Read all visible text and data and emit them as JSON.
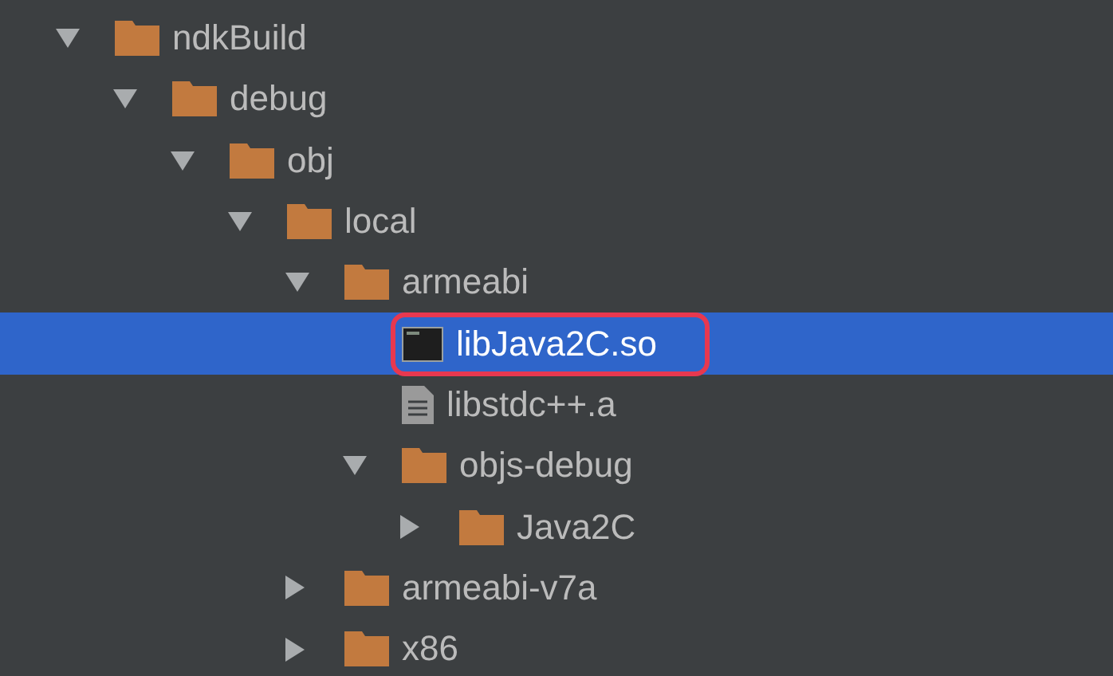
{
  "tree": [
    {
      "label": "ndkBuild",
      "kind": "folder",
      "expanded": true,
      "selected": false,
      "highlighted": false,
      "children": [
        {
          "label": "debug",
          "kind": "folder",
          "expanded": true,
          "selected": false,
          "highlighted": false,
          "children": [
            {
              "label": "obj",
              "kind": "folder",
              "expanded": true,
              "selected": false,
              "highlighted": false,
              "children": [
                {
                  "label": "local",
                  "kind": "folder",
                  "expanded": true,
                  "selected": false,
                  "highlighted": false,
                  "children": [
                    {
                      "label": "armeabi",
                      "kind": "folder",
                      "expanded": true,
                      "selected": false,
                      "highlighted": false,
                      "children": [
                        {
                          "label": "libJava2C.so",
                          "kind": "binary",
                          "selected": true,
                          "highlighted": true
                        },
                        {
                          "label": "libstdc++.a",
                          "kind": "file",
                          "selected": false,
                          "highlighted": false
                        },
                        {
                          "label": "objs-debug",
                          "kind": "folder",
                          "expanded": true,
                          "selected": false,
                          "highlighted": false,
                          "children": [
                            {
                              "label": "Java2C",
                              "kind": "folder",
                              "expanded": false,
                              "selected": false,
                              "highlighted": false
                            }
                          ]
                        }
                      ]
                    },
                    {
                      "label": "armeabi-v7a",
                      "kind": "folder",
                      "expanded": false,
                      "selected": false,
                      "highlighted": false
                    },
                    {
                      "label": "x86",
                      "kind": "folder",
                      "expanded": false,
                      "selected": false,
                      "highlighted": false
                    }
                  ]
                }
              ]
            }
          ]
        }
      ]
    }
  ]
}
